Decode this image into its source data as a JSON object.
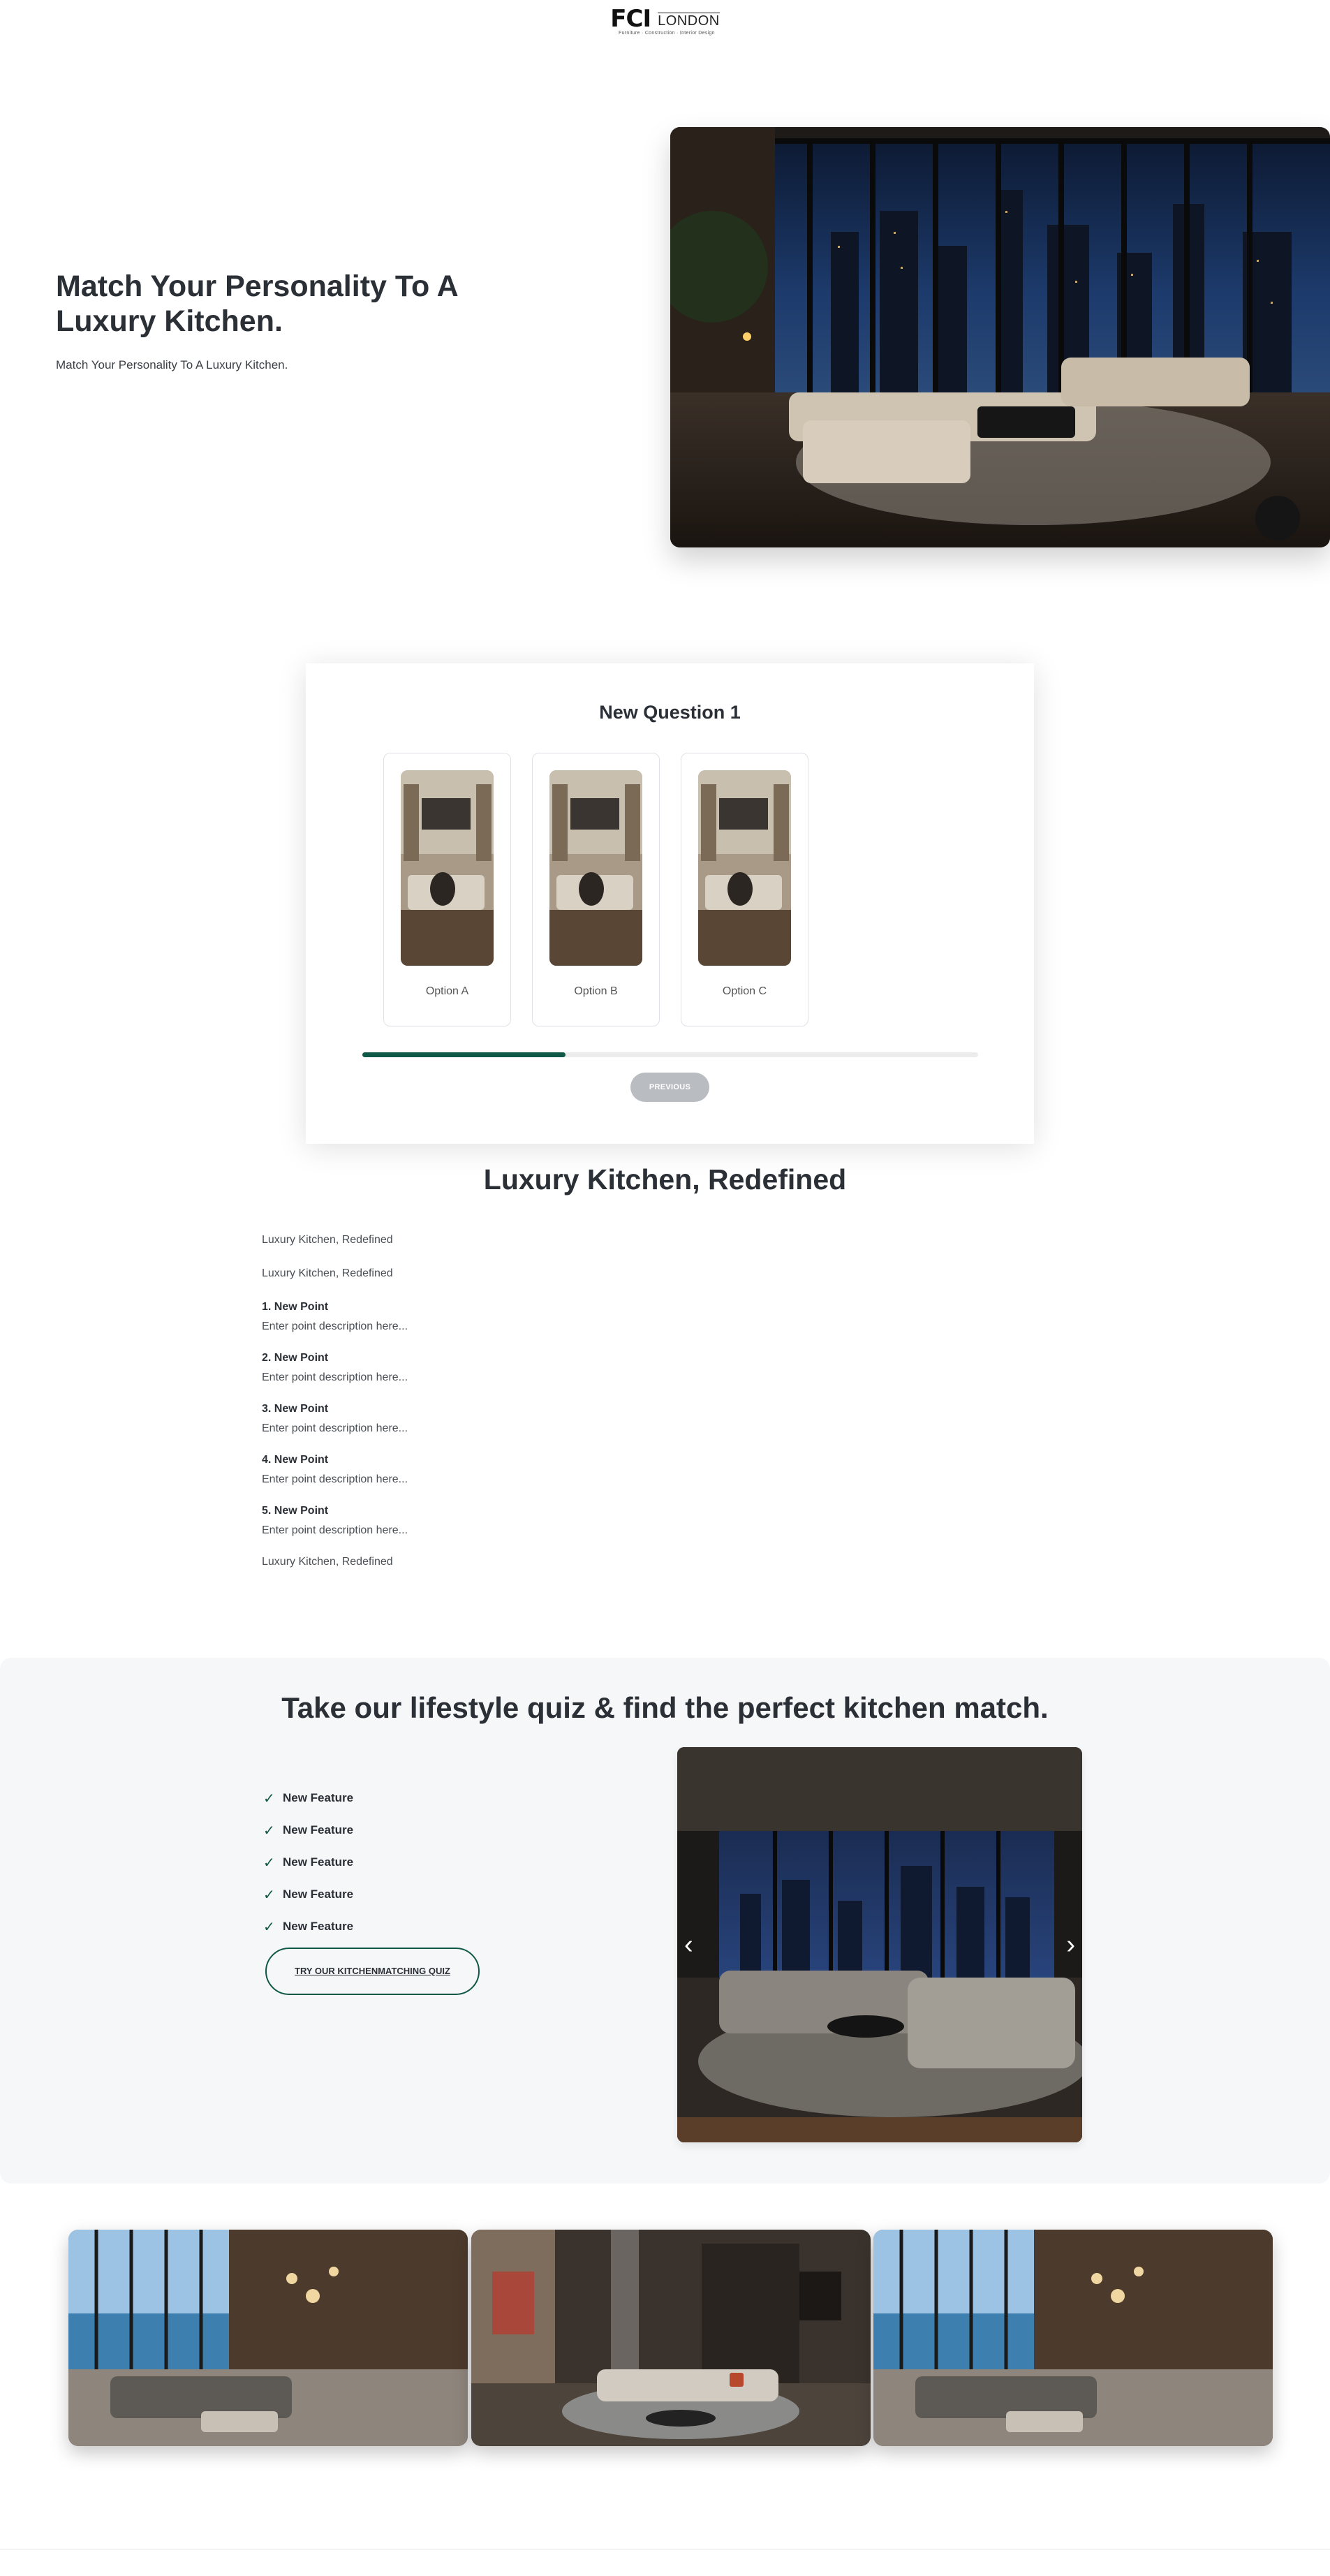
{
  "header": {
    "logo_mark": "FCI",
    "logo_city": "LONDON",
    "logo_tagline": "Furniture · Construction · Interior Design"
  },
  "hero": {
    "title": "Match Your Personality To A Luxury Kitchen.",
    "subtitle": "Match Your Personality To A Luxury Kitchen."
  },
  "quiz": {
    "question": "New Question 1",
    "options": [
      {
        "label": "Option A"
      },
      {
        "label": "Option B"
      },
      {
        "label": "Option C"
      }
    ],
    "progress_fraction": 0.33,
    "previous_label": "PREVIOUS"
  },
  "redefined": {
    "title": "Luxury Kitchen, Redefined",
    "intro_1": "Luxury Kitchen, Redefined",
    "intro_2": "Luxury Kitchen, Redefined",
    "points": [
      {
        "title": "1. New Point",
        "desc": "Enter point description here..."
      },
      {
        "title": "2. New Point",
        "desc": "Enter point description here..."
      },
      {
        "title": "3. New Point",
        "desc": "Enter point description here..."
      },
      {
        "title": "4. New Point",
        "desc": "Enter point description here..."
      },
      {
        "title": "5. New Point",
        "desc": "Enter point description here..."
      }
    ],
    "outro": "Luxury Kitchen, Redefined"
  },
  "lifestyle": {
    "title": "Take our lifestyle quiz & find the perfect kitchen match.",
    "features": [
      "New Feature",
      "New Feature",
      "New Feature",
      "New Feature",
      "New Feature"
    ],
    "check_icon": "✓",
    "cta_label": "TRY OUR KITCHENMATCHING QUIZ",
    "carousel_prev": "‹",
    "carousel_next": "›"
  },
  "colors": {
    "accent": "#0f5746",
    "text": "#2b2f36",
    "section_bg": "#f6f7f9"
  }
}
